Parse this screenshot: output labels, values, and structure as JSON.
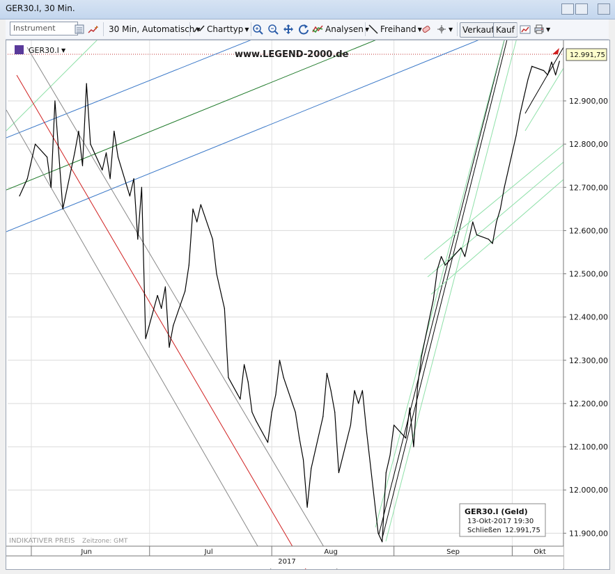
{
  "window": {
    "title": "GER30.I, 30 Min."
  },
  "toolbar": {
    "instrument_placeholder": "Instrument",
    "interval_label": "30 Min,  Automatisch",
    "charttype_label": "Charttyp",
    "analysen_label": "Analysen",
    "freihand_label": "Freihand",
    "verkauf_label": "Verkauf",
    "kauf_label": "Kauf"
  },
  "chart_header": {
    "symbol": "GER30.I",
    "watermark": "www.LEGEND-2000.de"
  },
  "last_price_label": "12.991,75",
  "footer": {
    "indicative": "INDIKATIVER PREIS",
    "timezone": "Zeitzone: GMT"
  },
  "infobox": {
    "title": "GER30.I (Geld)",
    "date": "13-Okt-2017 19:30",
    "close_label": "Schließen",
    "close_value": "12.991,75"
  },
  "chart_data": {
    "type": "line",
    "y_ticks": [
      "11.900,00",
      "12.000,00",
      "12.100,00",
      "12.200,00",
      "12.300,00",
      "12.400,00",
      "12.500,00",
      "12.600,00",
      "12.700,00",
      "12.800,00",
      "12.900,00"
    ],
    "ylim": [
      11870,
      13040
    ],
    "x_months": [
      "Jun",
      "Jul",
      "Aug",
      "Sep",
      "Okt"
    ],
    "year_label": "2017",
    "series": [
      {
        "color": "#000000",
        "points": [
          [
            "2017-05-29",
            12680
          ],
          [
            "2017-05-31",
            12720
          ],
          [
            "2017-06-02",
            12800
          ],
          [
            "2017-06-05",
            12770
          ],
          [
            "2017-06-06",
            12700
          ],
          [
            "2017-06-07",
            12900
          ],
          [
            "2017-06-09",
            12650
          ],
          [
            "2017-06-12",
            12780
          ],
          [
            "2017-06-13",
            12830
          ],
          [
            "2017-06-14",
            12750
          ],
          [
            "2017-06-15",
            12940
          ],
          [
            "2017-06-16",
            12800
          ],
          [
            "2017-06-19",
            12740
          ],
          [
            "2017-06-20",
            12780
          ],
          [
            "2017-06-21",
            12720
          ],
          [
            "2017-06-22",
            12830
          ],
          [
            "2017-06-23",
            12770
          ],
          [
            "2017-06-26",
            12680
          ],
          [
            "2017-06-27",
            12720
          ],
          [
            "2017-06-28",
            12580
          ],
          [
            "2017-06-29",
            12700
          ],
          [
            "2017-06-30",
            12350
          ],
          [
            "2017-07-03",
            12450
          ],
          [
            "2017-07-04",
            12420
          ],
          [
            "2017-07-05",
            12470
          ],
          [
            "2017-07-06",
            12330
          ],
          [
            "2017-07-07",
            12380
          ],
          [
            "2017-07-10",
            12460
          ],
          [
            "2017-07-11",
            12520
          ],
          [
            "2017-07-12",
            12650
          ],
          [
            "2017-07-13",
            12620
          ],
          [
            "2017-07-14",
            12660
          ],
          [
            "2017-07-17",
            12580
          ],
          [
            "2017-07-18",
            12500
          ],
          [
            "2017-07-19",
            12460
          ],
          [
            "2017-07-20",
            12420
          ],
          [
            "2017-07-21",
            12260
          ],
          [
            "2017-07-24",
            12210
          ],
          [
            "2017-07-25",
            12290
          ],
          [
            "2017-07-26",
            12250
          ],
          [
            "2017-07-27",
            12180
          ],
          [
            "2017-07-28",
            12160
          ],
          [
            "2017-07-31",
            12110
          ],
          [
            "2017-08-01",
            12180
          ],
          [
            "2017-08-02",
            12220
          ],
          [
            "2017-08-03",
            12300
          ],
          [
            "2017-08-04",
            12260
          ],
          [
            "2017-08-07",
            12180
          ],
          [
            "2017-08-08",
            12120
          ],
          [
            "2017-08-09",
            12070
          ],
          [
            "2017-08-10",
            11960
          ],
          [
            "2017-08-11",
            12050
          ],
          [
            "2017-08-14",
            12170
          ],
          [
            "2017-08-15",
            12270
          ],
          [
            "2017-08-16",
            12230
          ],
          [
            "2017-08-17",
            12180
          ],
          [
            "2017-08-18",
            12040
          ],
          [
            "2017-08-21",
            12150
          ],
          [
            "2017-08-22",
            12230
          ],
          [
            "2017-08-23",
            12200
          ],
          [
            "2017-08-24",
            12230
          ],
          [
            "2017-08-25",
            12140
          ],
          [
            "2017-08-28",
            11900
          ],
          [
            "2017-08-29",
            11880
          ],
          [
            "2017-08-30",
            12040
          ],
          [
            "2017-08-31",
            12080
          ],
          [
            "2017-09-01",
            12150
          ],
          [
            "2017-09-04",
            12120
          ],
          [
            "2017-09-05",
            12190
          ],
          [
            "2017-09-06",
            12100
          ],
          [
            "2017-09-07",
            12240
          ],
          [
            "2017-09-08",
            12310
          ],
          [
            "2017-09-11",
            12440
          ],
          [
            "2017-09-12",
            12510
          ],
          [
            "2017-09-13",
            12540
          ],
          [
            "2017-09-14",
            12520
          ],
          [
            "2017-09-15",
            12530
          ],
          [
            "2017-09-18",
            12560
          ],
          [
            "2017-09-19",
            12540
          ],
          [
            "2017-09-20",
            12580
          ],
          [
            "2017-09-21",
            12620
          ],
          [
            "2017-09-22",
            12590
          ],
          [
            "2017-09-25",
            12580
          ],
          [
            "2017-09-26",
            12570
          ],
          [
            "2017-09-27",
            12620
          ],
          [
            "2017-09-28",
            12650
          ],
          [
            "2017-09-29",
            12700
          ],
          [
            "2017-10-02",
            12820
          ],
          [
            "2017-10-03",
            12870
          ],
          [
            "2017-10-04",
            12910
          ],
          [
            "2017-10-05",
            12950
          ],
          [
            "2017-10-06",
            12980
          ],
          [
            "2017-10-09",
            12970
          ],
          [
            "2017-10-10",
            12960
          ],
          [
            "2017-10-11",
            12990
          ],
          [
            "2017-10-12",
            12960
          ],
          [
            "2017-10-13",
            12991.75
          ]
        ]
      }
    ]
  }
}
